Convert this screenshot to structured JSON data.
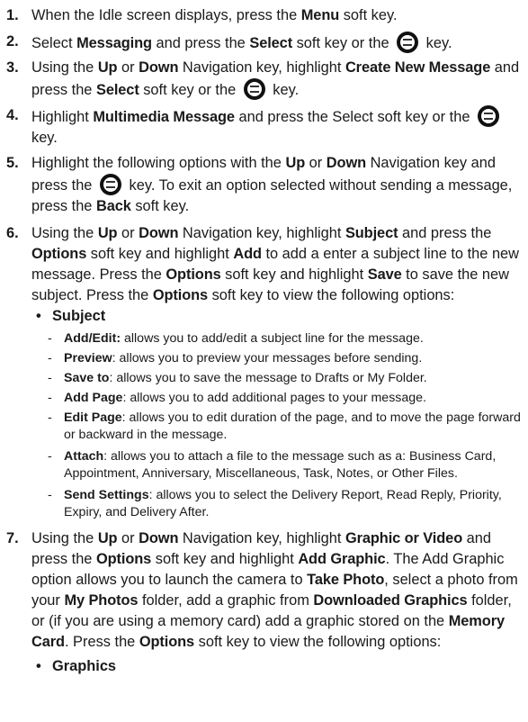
{
  "steps": [
    {
      "num": "1.",
      "segments": [
        {
          "t": "When the Idle screen displays, press the "
        },
        {
          "b": "Menu"
        },
        {
          "t": " soft key."
        }
      ]
    },
    {
      "num": "2.",
      "segments": [
        {
          "t": "Select "
        },
        {
          "b": "Messaging"
        },
        {
          "t": " and press the "
        },
        {
          "b": "Select"
        },
        {
          "t": " soft key or the "
        },
        {
          "key": "ok-key-icon"
        },
        {
          "t": " key."
        }
      ]
    },
    {
      "num": "3.",
      "lines": [
        [
          {
            "t": "Using the "
          },
          {
            "b": "Up"
          },
          {
            "t": " or "
          },
          {
            "b": "Down"
          },
          {
            "t": " Navigation key, highlight "
          },
          {
            "b": "Create New Message"
          },
          {
            "t": " and"
          }
        ],
        [
          {
            "t": "press the "
          },
          {
            "b": "Select"
          },
          {
            "t": " soft key or the "
          },
          {
            "key": "ok-key-icon"
          },
          {
            "t": " key."
          }
        ]
      ]
    },
    {
      "num": "4.",
      "lines": [
        [
          {
            "t": "Highlight "
          },
          {
            "b": "Multimedia Message"
          },
          {
            "t": " and press the Select soft key or the "
          },
          {
            "key": "ok-key-icon"
          }
        ],
        [
          {
            "t": "key."
          }
        ]
      ]
    },
    {
      "num": "5.",
      "lines": [
        [
          {
            "t": "Highlight the following options with the "
          },
          {
            "b": "Up"
          },
          {
            "t": " or "
          },
          {
            "b": "Down"
          },
          {
            "t": " Navigation key and"
          }
        ],
        [
          {
            "t": "press the "
          },
          {
            "key": "ok-key-icon"
          },
          {
            "t": " key. To exit an option selected without sending a message,"
          }
        ],
        [
          {
            "t": "press the "
          },
          {
            "b": "Back"
          },
          {
            "t": " soft key."
          }
        ]
      ]
    },
    {
      "num": "6.",
      "lines": [
        [
          {
            "t": "Using the "
          },
          {
            "b": "Up"
          },
          {
            "t": " or "
          },
          {
            "b": "Down"
          },
          {
            "t": " Navigation key, highlight "
          },
          {
            "b": "Subject"
          },
          {
            "t": " and press the"
          }
        ],
        [
          {
            "b": "Options"
          },
          {
            "t": " soft key and highlight "
          },
          {
            "b": "Add"
          },
          {
            "t": " to add a enter a subject line to the new"
          }
        ],
        [
          {
            "t": "message. Press the "
          },
          {
            "b": "Options"
          },
          {
            "t": " soft key and highlight "
          },
          {
            "b": "Save"
          },
          {
            "t": " to save the new"
          }
        ],
        [
          {
            "t": "subject. Press the "
          },
          {
            "b": "Options"
          },
          {
            "t": " soft key to view the following options:"
          }
        ]
      ]
    },
    {
      "num": "7.",
      "lines": [
        [
          {
            "t": "Using the "
          },
          {
            "b": "Up"
          },
          {
            "t": " or "
          },
          {
            "b": "Down"
          },
          {
            "t": " Navigation key, highlight "
          },
          {
            "b": "Graphic or Video"
          },
          {
            "t": " and"
          }
        ],
        [
          {
            "t": "press the "
          },
          {
            "b": "Options"
          },
          {
            "t": " soft key and highlight "
          },
          {
            "b": "Add Graphic"
          },
          {
            "t": ". The Add Graphic"
          }
        ],
        [
          {
            "t": "option allows you to launch the camera to "
          },
          {
            "b": "Take Photo"
          },
          {
            "t": ", select a photo from"
          }
        ],
        [
          {
            "t": "your "
          },
          {
            "b": "My Photos"
          },
          {
            "t": " folder, add a graphic from "
          },
          {
            "b": "Downloaded Graphics"
          },
          {
            "t": " folder,"
          }
        ],
        [
          {
            "t": "or (if you are using a memory card) add a graphic stored on the "
          },
          {
            "b": "Memory"
          }
        ],
        [
          {
            "b": "Card"
          },
          {
            "t": ".  Press the "
          },
          {
            "b": "Options"
          },
          {
            "t": " soft key to view the following options:"
          }
        ]
      ]
    }
  ],
  "subject_bullet": "Subject",
  "subject_options": [
    {
      "lines": [
        [
          {
            "b": "Add/Edit:"
          },
          {
            "t": " allows you to add/edit a subject line for the message."
          }
        ]
      ]
    },
    {
      "lines": [
        [
          {
            "b": "Preview"
          },
          {
            "t": ": allows you to preview your messages before sending."
          }
        ]
      ]
    },
    {
      "lines": [
        [
          {
            "b": "Save to"
          },
          {
            "t": ": allows you to save the message to Drafts or My Folder."
          }
        ]
      ]
    },
    {
      "lines": [
        [
          {
            "b": "Add Page"
          },
          {
            "t": ": allows you to add additional pages to your message."
          }
        ]
      ]
    },
    {
      "lines": [
        [
          {
            "b": "Edit Page"
          },
          {
            "t": ": allows you to edit duration of the page, and to move the page forward"
          }
        ],
        [
          {
            "t": "or backward in the message."
          }
        ]
      ]
    },
    {
      "lines": [
        [
          {
            "b": "Attach"
          },
          {
            "t": ": allows you to attach a file to the message such as a: Business Card,"
          }
        ],
        [
          {
            "t": "Appointment, Anniversary, Miscellaneous, Task, Notes, or Other Files."
          }
        ]
      ]
    },
    {
      "lines": [
        [
          {
            "b": "Send Settings"
          },
          {
            "t": ": allows you to select the Delivery Report, Read Reply, Priority,"
          }
        ],
        [
          {
            "t": "Expiry, and Delivery After."
          }
        ]
      ]
    }
  ],
  "graphics_bullet": "Graphics",
  "glyphs": {
    "bullet": "•",
    "dash": "-"
  }
}
